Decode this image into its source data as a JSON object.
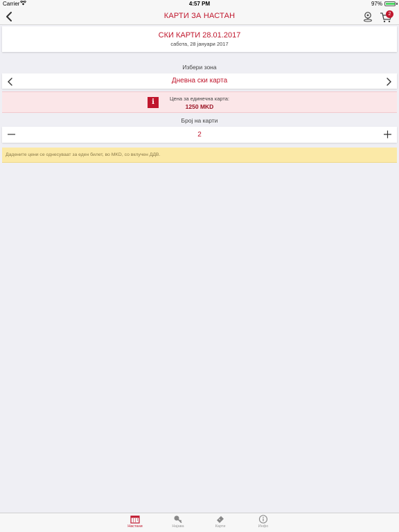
{
  "status_bar": {
    "carrier": "Carrier",
    "time": "4:57 PM",
    "battery": "97%",
    "battery_level": 0.97
  },
  "nav": {
    "title": "КАРТИ ЗА НАСТАН",
    "cart_count": "2",
    "icons": [
      "back-chevron-icon",
      "location-pin-icon",
      "cart-icon"
    ]
  },
  "header": {
    "title": "СКИ КАРТИ 28.01.2017",
    "subtitle": "сабота, 28 јануари 2017"
  },
  "zone": {
    "label": "Избери зона",
    "value": "Дневна ски карта"
  },
  "price": {
    "info_glyph": "i",
    "label": "Цена за единечна карта:",
    "value": "1250 MKD"
  },
  "quantity": {
    "label": "Број на карти",
    "value": "2"
  },
  "notice": {
    "text": "Дадените цени се однесуваат за еден билет, во MKD, со вклучен ДДВ."
  },
  "tabs": [
    {
      "label": "Настани",
      "icon": "calendar-icon",
      "active": true
    },
    {
      "label": "Најава",
      "icon": "key-icon",
      "active": false
    },
    {
      "label": "Карти",
      "icon": "ticket-icon",
      "active": false
    },
    {
      "label": "Инфо",
      "icon": "info-circle-icon",
      "active": false
    }
  ],
  "colors": {
    "accent": "#c0172d",
    "price_bg": "#fbe6e8",
    "notice_bg": "#fbe9a7",
    "page_bg": "#efeff4"
  }
}
